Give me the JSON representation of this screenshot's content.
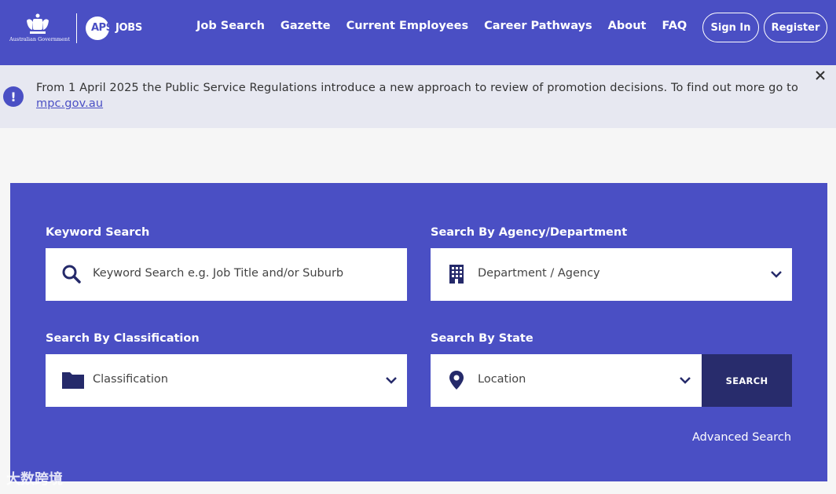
{
  "header": {
    "gov_name": "Australian Government",
    "brand_aps": "APS",
    "brand_jobs": "JOBS",
    "nav": [
      "Job Search",
      "Gazette",
      "Current Employees",
      "Career Pathways",
      "About",
      "FAQ"
    ],
    "sign_in": "Sign In",
    "register": "Register"
  },
  "notice": {
    "text": "From 1 April 2025 the Public Service Regulations introduce a new approach to review of promotion decisions. To find out more go to ",
    "link": "mpc.gov.au",
    "icon": "exclamation-icon"
  },
  "search": {
    "keyword_label": "Keyword Search",
    "keyword_placeholder": "Keyword Search e.g. Job Title and/or Suburb",
    "agency_label": "Search By Agency/Department",
    "agency_value": "Department / Agency",
    "classification_label": "Search By Classification",
    "classification_value": "Classification",
    "state_label": "Search By State",
    "state_value": "Location",
    "search_button": "SEARCH",
    "advanced_link": "Advanced Search"
  },
  "watermark": "大数跨境",
  "colors": {
    "primary": "#4a4fc4",
    "dark_button": "#282c6c",
    "notice_bg": "#e7e8f1",
    "icon_navy": "#252a6a"
  }
}
